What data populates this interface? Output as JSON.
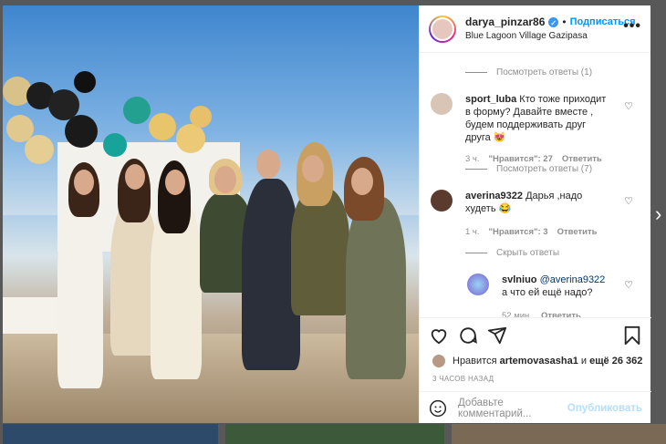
{
  "post": {
    "username": "darya_pinzar86",
    "follow_label": "Подписаться",
    "separator": "•",
    "location": "Blue Lagoon Village Gazipasa",
    "more_icon": "more-icon"
  },
  "comments": {
    "view_replies_1": "Посмотреть ответы (1)",
    "c1": {
      "user": "sport_luba",
      "text": "Кто тоже приходит в форму? Давайте вместе , будем поддерживать друг друга",
      "emoji": "😻",
      "time": "3 ч.",
      "likes": "\"Нравится\": 27",
      "reply": "Ответить"
    },
    "view_replies_2": "Посмотреть ответы (7)",
    "c2": {
      "user": "averina9322",
      "text": "Дарья ,надо худеть",
      "emoji": "😂",
      "time": "1 ч.",
      "likes": "\"Нравится\": 3",
      "reply": "Ответить"
    },
    "hide_replies": "Скрыть ответы",
    "c3": {
      "user": "svlniuo",
      "mention": "@averina9322",
      "text": "а что ей ещё надо?",
      "time": "52 мин.",
      "reply": "Ответить"
    }
  },
  "actions": {
    "likes_prefix": "Нравится",
    "likes_user": "artemovasasha1",
    "likes_conj": "и",
    "likes_count": "ещё 26 362",
    "posted_time": "3 ЧАСОВ НАЗАД",
    "comment_placeholder": "Добавьте комментарий...",
    "publish_label": "Опубликовать"
  },
  "colors": {
    "accent": "#0095f6",
    "text": "#262626",
    "muted": "#8e8e8e",
    "overlay": "#585858"
  }
}
